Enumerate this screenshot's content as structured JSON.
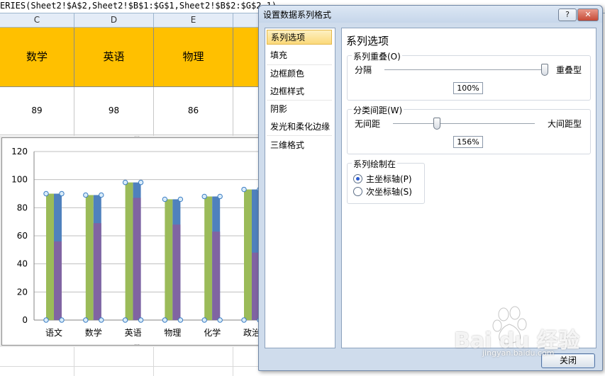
{
  "formula_bar": {
    "text": "ERIES(Sheet2!$A$2,Sheet2!$B$1:$G$1,Sheet2!$B$2:$G$2,1)"
  },
  "sheet": {
    "columns": [
      "C",
      "D",
      "E"
    ],
    "header_row": [
      "数学",
      "英语",
      "物理"
    ],
    "value_row": [
      "89",
      "98",
      "86"
    ]
  },
  "chart_data": {
    "type": "bar",
    "categories": [
      "语文",
      "数学",
      "英语",
      "物理",
      "化学",
      "政治"
    ],
    "y_ticks": [
      "120",
      "100",
      "80",
      "60",
      "40",
      "20",
      "0"
    ],
    "ylim": [
      0,
      120
    ],
    "series": [
      {
        "color": "#9bbb59",
        "values": [
          90,
          89,
          98,
          86,
          88,
          93
        ]
      },
      {
        "color": "#4f81bd",
        "values": [
          90,
          89,
          98,
          86,
          88,
          93
        ]
      },
      {
        "color": "#8064a2",
        "values": [
          56,
          69,
          87,
          68,
          63,
          48
        ]
      }
    ]
  },
  "dialog": {
    "title": "设置数据系列格式",
    "help_label": "?",
    "close_x_label": "✕",
    "nav": [
      "系列选项",
      "填充",
      "边框颜色",
      "边框样式",
      "阴影",
      "发光和柔化边缘",
      "三维格式"
    ],
    "panel_title": "系列选项",
    "overlap": {
      "label": "系列重叠(O)",
      "left": "分隔",
      "right": "重叠型",
      "value": "100%",
      "level": 1.0
    },
    "gap": {
      "label": "分类间距(W)",
      "left": "无间距",
      "right": "大间距型",
      "value": "156%",
      "level": 0.31
    },
    "axis": {
      "label": "系列绘制在",
      "primary": "主坐标轴(P)",
      "secondary": "次坐标轴(S)",
      "selected": "primary"
    },
    "close_button": "关闭"
  },
  "watermark": {
    "text": "Bai du 经验",
    "url": "jingyan.baidu.com"
  }
}
